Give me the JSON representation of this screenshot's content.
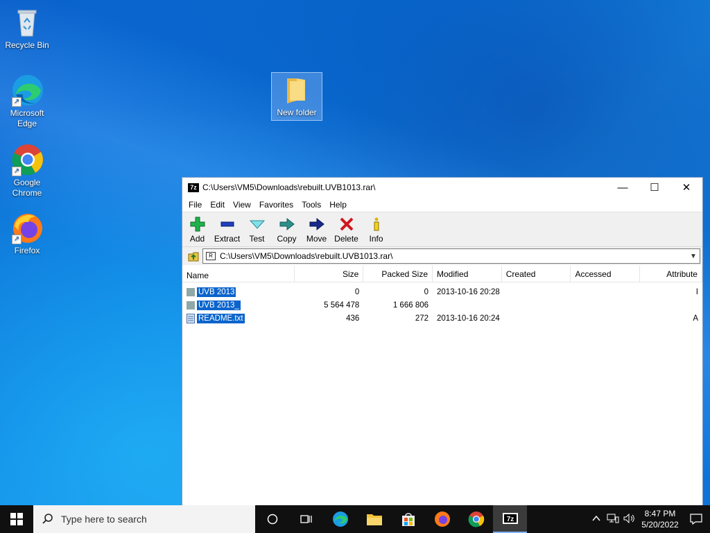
{
  "desktop": {
    "icons": [
      {
        "label": "Recycle Bin",
        "icon": "recycle-bin-icon"
      },
      {
        "label": "Microsoft Edge",
        "icon": "edge-icon"
      },
      {
        "label": "Google Chrome",
        "icon": "chrome-icon"
      },
      {
        "label": "Firefox",
        "icon": "firefox-icon"
      },
      {
        "label": "New folder",
        "icon": "folder-icon"
      }
    ]
  },
  "window": {
    "title": "C:\\Users\\VM5\\Downloads\\rebuilt.UVB1013.rar\\",
    "app_badge": "7z",
    "controls": {
      "minimize": "—",
      "maximize": "☐",
      "close": "✕"
    },
    "menu": [
      "File",
      "Edit",
      "View",
      "Favorites",
      "Tools",
      "Help"
    ],
    "toolbar": [
      {
        "label": "Add",
        "icon": "add-icon"
      },
      {
        "label": "Extract",
        "icon": "extract-icon"
      },
      {
        "label": "Test",
        "icon": "test-icon"
      },
      {
        "label": "Copy",
        "icon": "copy-icon"
      },
      {
        "label": "Move",
        "icon": "move-icon"
      },
      {
        "label": "Delete",
        "icon": "delete-icon"
      },
      {
        "label": "Info",
        "icon": "info-icon"
      }
    ],
    "address": "C:\\Users\\VM5\\Downloads\\rebuilt.UVB1013.rar\\",
    "columns": [
      "Name",
      "Size",
      "Packed Size",
      "Modified",
      "Created",
      "Accessed",
      "Attribute"
    ],
    "rows": [
      {
        "name": "UVB 2013",
        "size": "0",
        "packed": "0",
        "modified": "2013-10-16 20:28",
        "created": "",
        "accessed": "",
        "attr": "I",
        "type": "folder"
      },
      {
        "name": "UVB 2013_",
        "size": "5 564 478",
        "packed": "1 666 806",
        "modified": "",
        "created": "",
        "accessed": "",
        "attr": "",
        "type": "folder"
      },
      {
        "name": "README.txt",
        "size": "436",
        "packed": "272",
        "modified": "2013-10-16 20:24",
        "created": "",
        "accessed": "",
        "attr": "A",
        "type": "text"
      }
    ]
  },
  "taskbar": {
    "search_placeholder": "Type here to search",
    "apps": [
      "cortana-icon",
      "task-view-icon",
      "edge-icon",
      "file-explorer-icon",
      "store-icon",
      "firefox-icon",
      "chrome-icon",
      "7zip-icon"
    ],
    "time": "8:47 PM",
    "date": "5/20/2022"
  },
  "colors": {
    "selection": "#0a64cc",
    "taskbar": "#101010",
    "desktop": "#0b7ae0"
  }
}
